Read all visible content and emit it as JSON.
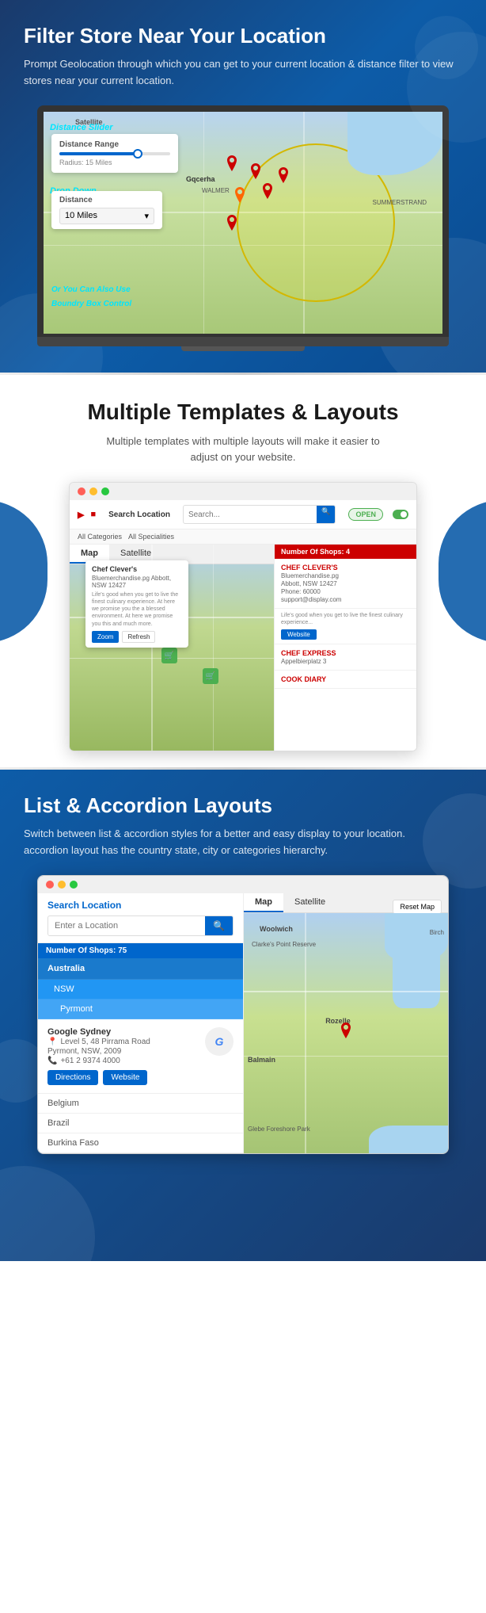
{
  "section1": {
    "title": "Filter Store Near Your Location",
    "subtitle": "Prompt Geolocation through which you can get to your current location & distance filter to view stores near your current location.",
    "distance_slider_label": "Distance Slider",
    "distance_range_label": "Distance Range",
    "radius_text": "Radius: 15 Miles",
    "dropdown_label": "Drop Down",
    "distance_label": "Distance",
    "distance_value": "10 Miles",
    "annotation_bounding": "Or You Can Also Use Boundry Box Control",
    "satellite_label": "Satellite"
  },
  "section2": {
    "title": "Multiple Templates & Layouts",
    "subtitle": "Multiple templates with multiple layouts will make it easier to adjust on your website.",
    "search_placeholder": "Search Location",
    "open_label": "OPEN",
    "categories_label": "All Categories",
    "specialties_label": "All Specialities",
    "stores_count": "Number Of Shops: 4",
    "store1_name": "CHEF CLEVER'S",
    "store1_address": "Bluemerchandise.pg",
    "store1_phone1": "Abbott, NSW 12427",
    "store1_phone2": "Phone: 60000",
    "store1_email": "support@display.com",
    "store2_name": "CHEF EXPRESS",
    "store2_address": "Appelbierplatz 3",
    "store3_name": "COOK DIARY",
    "map_tab_map": "Map",
    "map_tab_satellite": "Satellite",
    "popup_name": "Chef Clever's",
    "popup_address": "Bluemerchandise.pg Abbott, NSW 12427",
    "popup_desc": "Life's good when you get to live the finest culinary experience. At here we promise you the a blessed environment. At here we promise you this and much more.",
    "popup_btn1": "Zoom",
    "popup_btn2": "Refresh",
    "website_btn": "Website"
  },
  "section3": {
    "title": "List & Accordion Layouts",
    "subtitle": "Switch between list & accordion styles for a better and easy display to your location. accordion layout has the country state, city or categories hierarchy.",
    "search_label": "Search Location",
    "search_placeholder": "Enter a Location",
    "shops_count": "Number Of Shops: 75",
    "country1": "Australia",
    "state1": "NSW",
    "city1": "Pyrmont",
    "store_name": "Google Sydney",
    "store_address_line1": "Level 5, 48 Pirrama Road",
    "store_address_line2": "Pyrmont, NSW, 2009",
    "store_phone": "+61 2 9374 4000",
    "btn_directions": "Directions",
    "btn_website": "Website",
    "country2": "Belgium",
    "country3": "Brazil",
    "country4": "Burkina Faso",
    "map_tab1": "Map",
    "map_tab2": "Satellite",
    "reset_map": "Reset Map",
    "area1": "Woolwich",
    "area2": "Clarke's Point Reserve",
    "area3": "Birch",
    "area4": "Balmain",
    "area5": "Rozelle",
    "area6": "Glebe Foreshore Park",
    "google_logo": "Google"
  }
}
